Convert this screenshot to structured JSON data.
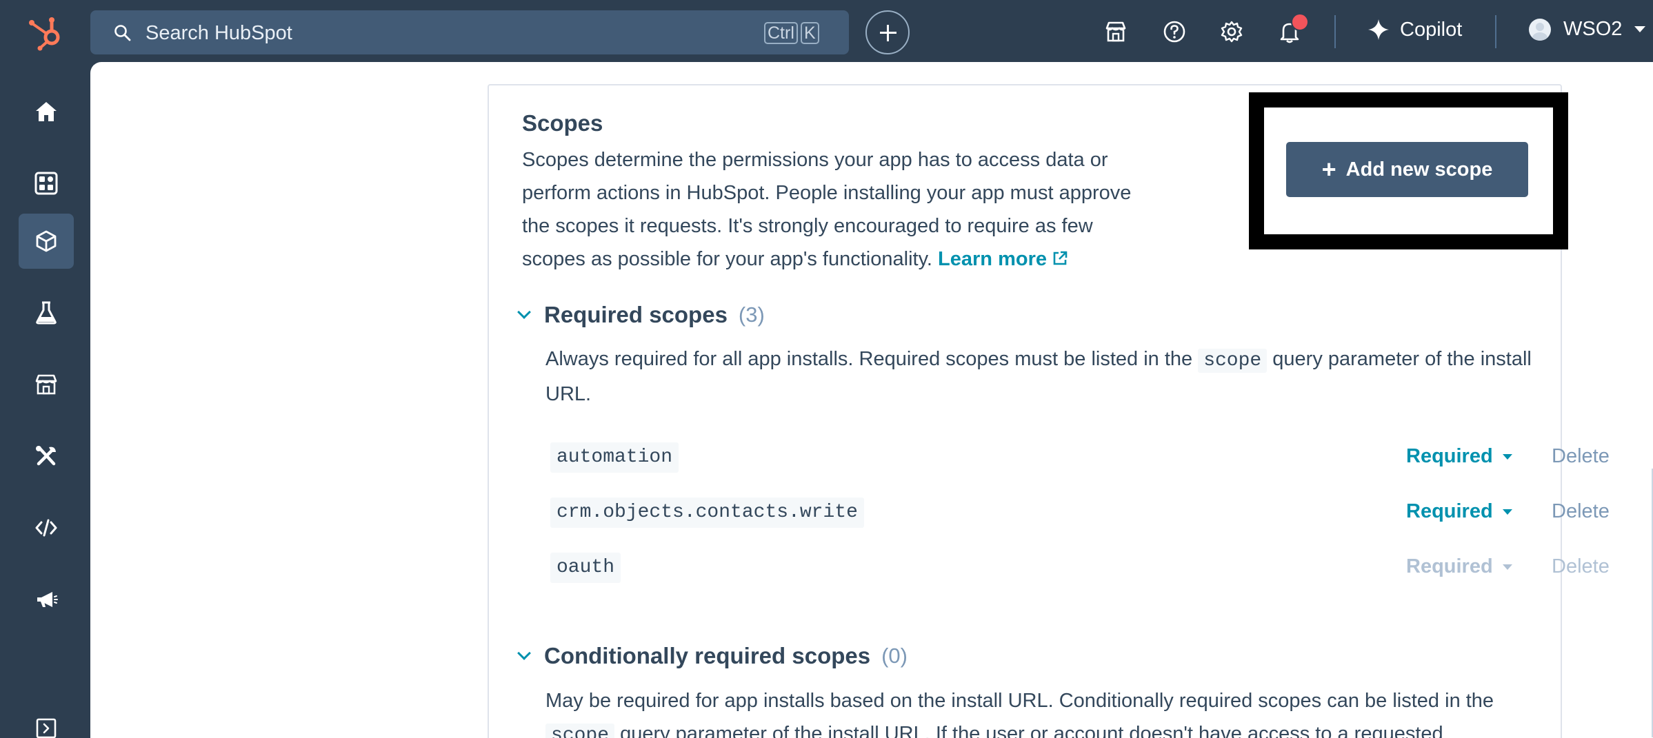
{
  "topbar": {
    "search_placeholder": "Search HubSpot",
    "shortcut_ctrl": "Ctrl",
    "shortcut_k": "K",
    "copilot_label": "Copilot",
    "account_name": "WSO2"
  },
  "colors": {
    "nav_bg": "#2d3e50",
    "accent": "#0091ae",
    "primary_button": "#425b76",
    "brand": "#ff7a59",
    "notification": "#f2545b"
  },
  "sidenav": {
    "items": [
      {
        "icon": "home-icon"
      },
      {
        "icon": "dashboard-icon"
      },
      {
        "icon": "app-cube-icon",
        "active": true
      },
      {
        "icon": "flask-icon"
      },
      {
        "icon": "marketplace-icon"
      },
      {
        "icon": "tools-icon"
      },
      {
        "icon": "code-icon"
      },
      {
        "icon": "megaphone-icon"
      },
      {
        "icon": "expand-sidebar-icon"
      }
    ]
  },
  "scopes": {
    "title": "Scopes",
    "description": "Scopes determine the permissions your app has to access data or perform actions in HubSpot. People installing your app must approve the scopes it requests. It's strongly encouraged to require as few scopes as possible for your app's functionality.",
    "learn_more": "Learn more",
    "add_button": "Add new scope"
  },
  "required": {
    "title": "Required scopes",
    "count": "(3)",
    "desc_before": "Always required for all app installs. Required scopes must be listed in the",
    "desc_code": "scope",
    "desc_after": "query parameter of the install URL.",
    "rows": [
      {
        "name": "automation",
        "status": "Required",
        "action": "Delete"
      },
      {
        "name": "crm.objects.contacts.write",
        "status": "Required",
        "action": "Delete"
      },
      {
        "name": "oauth",
        "status": "Required",
        "action": "Delete",
        "disabled": true
      }
    ]
  },
  "conditional": {
    "title": "Conditionally required scopes",
    "count": "(0)",
    "desc_before": "May be required for app installs based on the install URL. Conditionally required scopes can be listed in the",
    "desc_code": "scope",
    "desc_after": "query parameter of the install URL. If the user or account doesn't have access to a requested"
  }
}
